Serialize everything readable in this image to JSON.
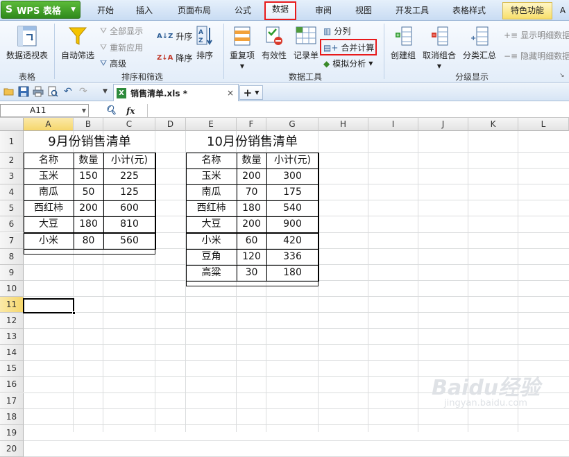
{
  "app": {
    "name": "WPS 表格"
  },
  "menu_tabs": [
    "开始",
    "插入",
    "页面布局",
    "公式",
    "数据",
    "审阅",
    "视图",
    "开发工具",
    "表格样式",
    "特色功能",
    "A"
  ],
  "ribbon": {
    "pivot_label": "数据透视表",
    "autofilter_label": "自动筛选",
    "show_all_label": "全部显示",
    "reapply_label": "重新应用",
    "advanced_label": "高级",
    "sort_asc_label": "升序",
    "sort_desc_label": "降序",
    "sort_label": "排序",
    "duplicates_label": "重复项",
    "validity_label": "有效性",
    "record_label": "记录单",
    "split_label": "分列",
    "consolidate_label": "合并计算",
    "whatif_label": "模拟分析",
    "group_label": "创建组",
    "ungroup_label": "取消组合",
    "subtotal_label": "分类汇总",
    "show_detail_label": "显示明细数据",
    "hide_detail_label": "隐藏明细数据",
    "groups": {
      "table": "表格",
      "sort_filter": "排序和筛选",
      "data_tools": "数据工具",
      "outline": "分级显示"
    }
  },
  "file_tab": {
    "name": "销售清单.xls *",
    "close": "×"
  },
  "formula_bar": {
    "cell_ref": "A11",
    "value": ""
  },
  "columns": [
    "A",
    "B",
    "C",
    "D",
    "E",
    "F",
    "G",
    "H",
    "I",
    "J",
    "K",
    "L"
  ],
  "rows": [
    "1",
    "2",
    "3",
    "4",
    "5",
    "6",
    "7",
    "8",
    "9",
    "10",
    "11",
    "12",
    "13",
    "14",
    "15",
    "16",
    "17",
    "18",
    "19",
    "20"
  ],
  "table_sep": {
    "title": "9月份销售清单",
    "headers": [
      "名称",
      "数量",
      "小计(元)"
    ],
    "rows": [
      [
        "玉米",
        "150",
        "225"
      ],
      [
        "南瓜",
        "50",
        "125"
      ],
      [
        "西红柿",
        "200",
        "600"
      ],
      [
        "大豆",
        "180",
        "810"
      ],
      [
        "小米",
        "80",
        "560"
      ]
    ]
  },
  "table_oct": {
    "title": "10月份销售清单",
    "headers": [
      "名称",
      "数量",
      "小计(元)"
    ],
    "rows": [
      [
        "玉米",
        "200",
        "300"
      ],
      [
        "南瓜",
        "70",
        "175"
      ],
      [
        "西红柿",
        "180",
        "540"
      ],
      [
        "大豆",
        "200",
        "900"
      ],
      [
        "小米",
        "60",
        "420"
      ],
      [
        "豆角",
        "120",
        "336"
      ],
      [
        "高粱",
        "30",
        "180"
      ]
    ]
  },
  "watermark": {
    "main": "Baidu经验",
    "sub": "jingyan.baidu.com"
  },
  "colors": {
    "highlight": "#e8191a",
    "selected_header": "#f5d66b",
    "logo_green": "#3a9a22"
  }
}
